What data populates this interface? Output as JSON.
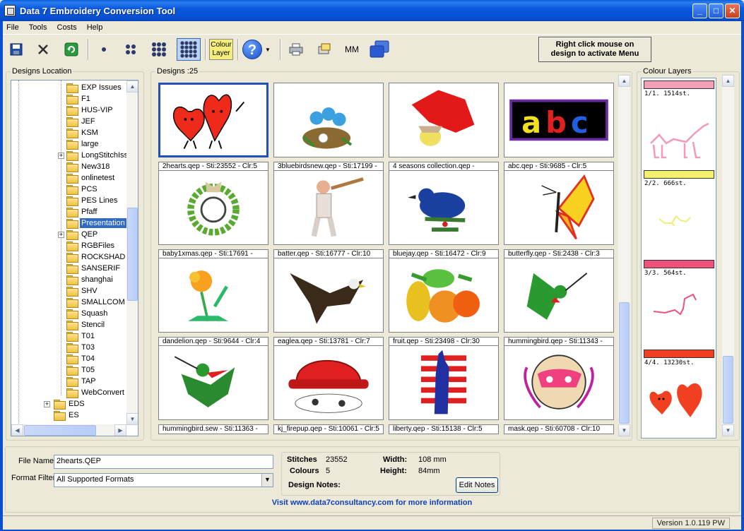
{
  "window": {
    "title": "Data 7 Embroidery Conversion Tool"
  },
  "menu": [
    "File",
    "Tools",
    "Costs",
    "Help"
  ],
  "toolbar": {
    "colour_layer_line1": "Colour",
    "colour_layer_line2": "Layer",
    "mm_label": "MM",
    "hint_line1": "Right click mouse on",
    "hint_line2": "design to activate Menu"
  },
  "designs_location": {
    "title": "Designs Location",
    "folders": [
      "EXP Issues",
      "F1",
      "HUS-VIP",
      "JEF",
      "KSM",
      "large",
      "LongStitchIssu",
      "New318",
      "onlinetest",
      "PCS",
      "PES Lines",
      "Pfaff",
      "Presentation",
      "QEP",
      "RGBFiles",
      "ROCKSHAD",
      "SANSERIF",
      "shanghai",
      "SHV",
      "SMALLCOM",
      "Squash",
      "Stencil",
      "T01",
      "T03",
      "T04",
      "T05",
      "TAP",
      "WebConvert"
    ],
    "root_folders": [
      "EDS",
      "ES"
    ],
    "selected": "Presentation"
  },
  "designs": {
    "title": "Designs :25",
    "items": [
      {
        "caption": "2hearts.qep - Sti:23552 - Clr:5",
        "icon": "hearts"
      },
      {
        "caption": "3bluebirdsnew.qep - Sti:17199 -",
        "icon": "bluebirds"
      },
      {
        "caption": "4 seasons collection.qep -",
        "icon": "seasons"
      },
      {
        "caption": "abc.qep - Sti:9685 - Clr:5",
        "icon": "abc"
      },
      {
        "caption": "baby1xmas.qep - Sti:17691 -",
        "icon": "wreath"
      },
      {
        "caption": "batter.qep - Sti:16777 - Clr:10",
        "icon": "batter"
      },
      {
        "caption": "bluejay.qep - Sti:16472 - Clr:9",
        "icon": "bluejay"
      },
      {
        "caption": "butterfly.qep - Sti:2438 - Clr:3",
        "icon": "butterfly"
      },
      {
        "caption": "dandelion.qep - Sti:9644 - Clr:4",
        "icon": "dandelion"
      },
      {
        "caption": "eaglea.qep - Sti:13781 - Clr:7",
        "icon": "eagle"
      },
      {
        "caption": "fruit.qep - Sti:23498 - Clr:30",
        "icon": "fruit"
      },
      {
        "caption": "hummingbird.qep - Sti:11343 -",
        "icon": "hummingbird"
      },
      {
        "caption": "hummingbird.sew - Sti:11363 -",
        "icon": "hummingbird2"
      },
      {
        "caption": "kj_firepup.qep - Sti:10061 - Clr:5",
        "icon": "firehat"
      },
      {
        "caption": "liberty.qep - Sti:15138 - Clr:5",
        "icon": "liberty"
      },
      {
        "caption": "mask.qep - Sti:60708 - Clr:10",
        "icon": "mask"
      }
    ]
  },
  "colour_layers": {
    "title": "Colour Layers",
    "layers": [
      {
        "label": "1/1. 1514st.",
        "color": "#f4a0b8"
      },
      {
        "label": "2/2. 666st.",
        "color": "#f4f070"
      },
      {
        "label": "3/3. 564st.",
        "color": "#f0507a"
      },
      {
        "label": "4/4. 13230st.",
        "color": "#f04020"
      }
    ]
  },
  "file_info": {
    "file_name_label": "File Name",
    "file_name": "2hearts.QEP",
    "format_filter_label": "Format Filter",
    "format_filter": "All Supported Formats",
    "stitches_label": "Stitches",
    "stitches": "23552",
    "colours_label": "Colours",
    "colours": "5",
    "width_label": "Width:",
    "width": "108 mm",
    "height_label": "Height:",
    "height": "84mm",
    "notes_label": "Design Notes:",
    "edit_notes": "Edit Notes"
  },
  "link_text": "Visit www.data7consultancy.com for more information",
  "status": {
    "version": "Version 1.0.119 PW"
  }
}
